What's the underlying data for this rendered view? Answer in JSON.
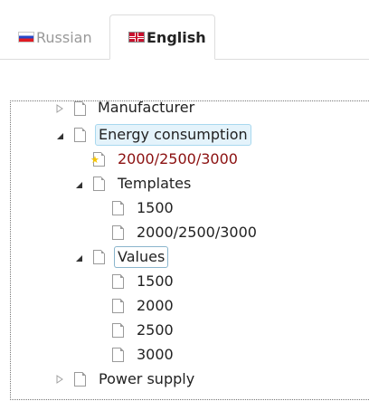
{
  "tabs": [
    {
      "label": "Russian",
      "flag": "flag-russia-icon",
      "active": false
    },
    {
      "label": "English",
      "flag": "flag-uk-icon",
      "active": true
    }
  ],
  "tree": {
    "nodes": [
      {
        "label": "Manufacturer",
        "state": "collapsed",
        "level": 0
      },
      {
        "label": "Energy consumption",
        "state": "expanded",
        "level": 0,
        "style": "hover"
      },
      {
        "label": "2000/2500/3000",
        "state": "leaf",
        "level": 1,
        "style": "starred"
      },
      {
        "label": "Templates",
        "state": "expanded",
        "level": 1
      },
      {
        "label": "1500",
        "state": "leaf",
        "level": 2
      },
      {
        "label": "2000/2500/3000",
        "state": "leaf",
        "level": 2
      },
      {
        "label": "Values",
        "state": "expanded",
        "level": 1,
        "style": "selected"
      },
      {
        "label": "1500",
        "state": "leaf",
        "level": 2
      },
      {
        "label": "2000",
        "state": "leaf",
        "level": 2
      },
      {
        "label": "2500",
        "state": "leaf",
        "level": 2
      },
      {
        "label": "3000",
        "state": "leaf",
        "level": 2
      },
      {
        "label": "Power supply",
        "state": "collapsed",
        "level": 0
      }
    ]
  },
  "colors": {
    "accent_hover_bg": "#e4f3fb",
    "accent_hover_border": "#a8d8ef",
    "starred_text": "#8b1010",
    "star": "#f5c400"
  }
}
